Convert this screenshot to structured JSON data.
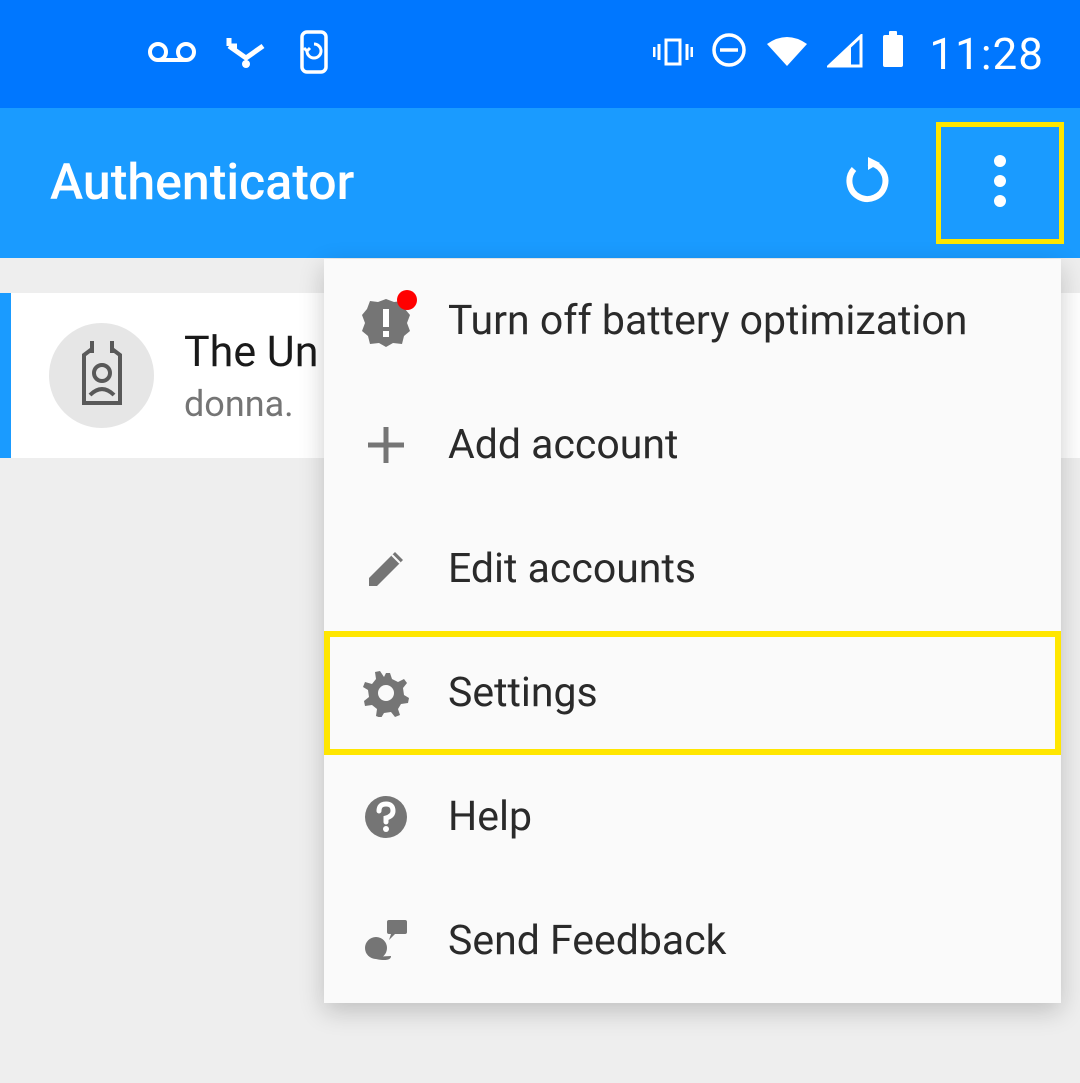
{
  "status_bar": {
    "time": "11:28"
  },
  "app_bar": {
    "title": "Authenticator"
  },
  "account": {
    "title": "The Un",
    "email": "donna."
  },
  "menu": {
    "items": [
      {
        "label": "Turn off battery optimization",
        "icon": "warning-badge"
      },
      {
        "label": "Add account",
        "icon": "plus"
      },
      {
        "label": "Edit accounts",
        "icon": "pencil"
      },
      {
        "label": "Settings",
        "icon": "gear",
        "highlighted": true
      },
      {
        "label": "Help",
        "icon": "question"
      },
      {
        "label": "Send Feedback",
        "icon": "feedback"
      }
    ]
  }
}
